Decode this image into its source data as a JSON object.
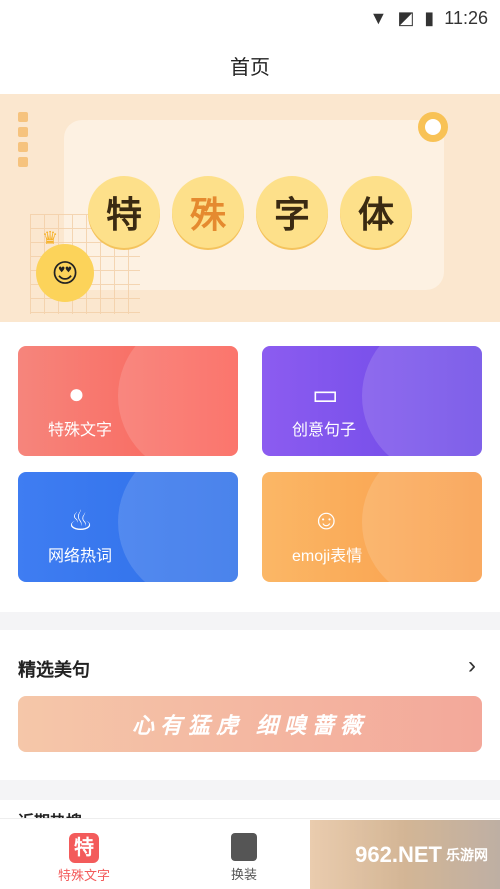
{
  "status": {
    "time": "11:26",
    "wifi_icon": "wifi-icon",
    "signal_icon": "no-signal-icon",
    "battery_icon": "battery-icon"
  },
  "header": {
    "title": "首页"
  },
  "banner": {
    "chars": [
      "特",
      "殊",
      "字",
      "体"
    ]
  },
  "menu": [
    {
      "label": "特殊文字",
      "icon": "bubbles-icon"
    },
    {
      "label": "创意句子",
      "icon": "cards-icon"
    },
    {
      "label": "网络热词",
      "icon": "fire-icon"
    },
    {
      "label": "emoji表情",
      "icon": "smile-icon"
    }
  ],
  "selected": {
    "title": "精选美句",
    "quote": "心有猛虎 细嗅蔷薇"
  },
  "recent": {
    "title": "近期热搜"
  },
  "tabs": [
    {
      "label": "特殊文字",
      "icon_char": "特",
      "active": true
    },
    {
      "label": "换装",
      "active": false
    }
  ],
  "watermark": {
    "text": "962.NET",
    "sub": "乐游网"
  },
  "colors": {
    "accent": "#f35b5b",
    "banner_bg": "#fbe7cf"
  }
}
